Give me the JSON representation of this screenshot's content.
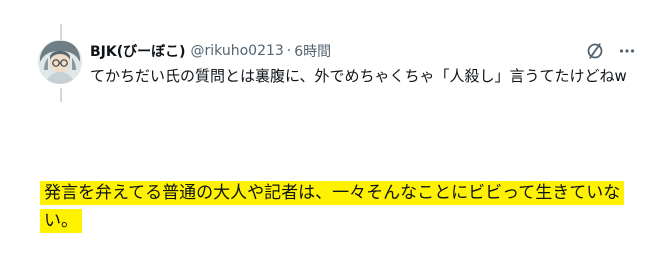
{
  "tweet": {
    "display_name": "BJK(びーぼこ)",
    "handle": "@rikuho0213",
    "separator": "·",
    "time": "6時間",
    "body": "てかちだい氏の質問とは裏腹に、外でめちゃくちゃ「人殺し」言うてたけどねw",
    "actions": {
      "grok_icon": "slash-circle-icon",
      "more_icon": "more-icon"
    }
  },
  "highlight": {
    "text": "発言を弁えてる普通の大人や記者は、一々そんなことにビビって生きていない。",
    "color": "#fff200"
  }
}
